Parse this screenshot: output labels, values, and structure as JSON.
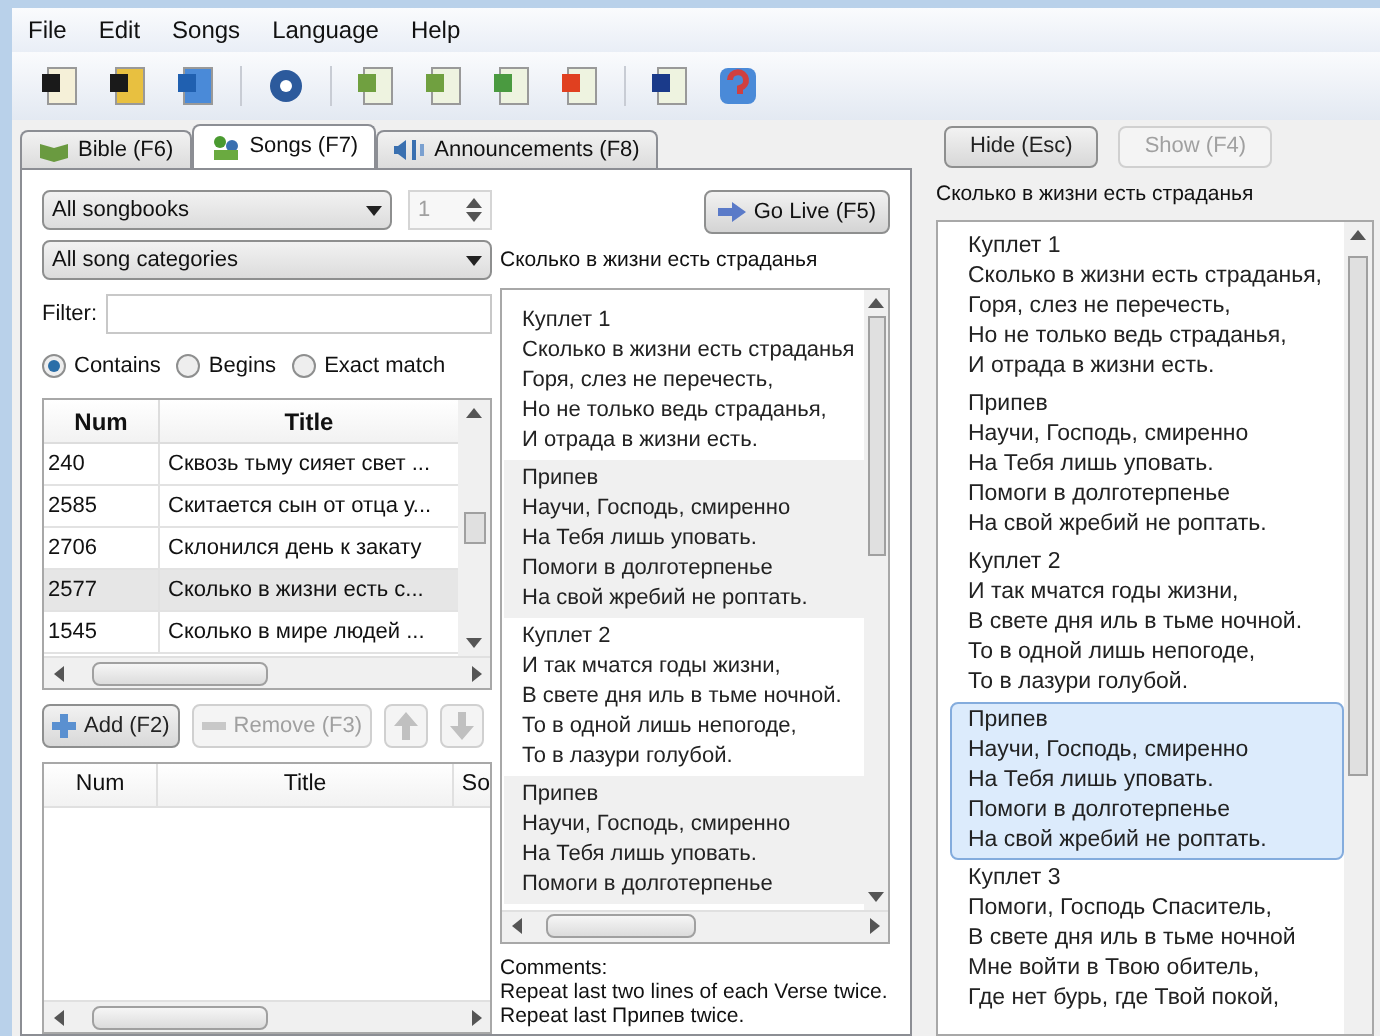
{
  "menu": [
    "File",
    "Edit",
    "Songs",
    "Language",
    "Help"
  ],
  "tabs": [
    {
      "label": "Bible (F6)",
      "selected": false,
      "kind": "book"
    },
    {
      "label": "Songs (F7)",
      "selected": true,
      "kind": "songs"
    },
    {
      "label": "Announcements (F8)",
      "selected": false,
      "kind": "speaker"
    }
  ],
  "songbook_select": {
    "value": "All songbooks"
  },
  "songbook_number": {
    "value": "1",
    "disabled": true
  },
  "category_select": {
    "value": "All song categories"
  },
  "filter": {
    "label": "Filter:"
  },
  "match_options": [
    {
      "label": "Contains",
      "selected": true
    },
    {
      "label": "Begins",
      "selected": false
    },
    {
      "label": "Exact match",
      "selected": false
    }
  ],
  "songs_table": {
    "columns": [
      "Num",
      "Title"
    ],
    "rows": [
      {
        "num": "240",
        "title": "Сквозь тьму сияет свет ...",
        "selected": false
      },
      {
        "num": "2585",
        "title": "Скитается сын от отца у...",
        "selected": false
      },
      {
        "num": "2706",
        "title": "Склонился день к закату",
        "selected": false
      },
      {
        "num": "2577",
        "title": "Сколько в жизни есть с...",
        "selected": true
      },
      {
        "num": "1545",
        "title": "Сколько в мире людей ...",
        "selected": false
      }
    ]
  },
  "playlist_buttons": [
    {
      "label": "Add (F2)",
      "kind": "add",
      "disabled": false
    },
    {
      "label": "Remove (F3)",
      "kind": "remove",
      "disabled": true
    },
    {
      "kind": "up",
      "disabled": true
    },
    {
      "kind": "down",
      "disabled": true
    }
  ],
  "playlist_table": {
    "columns": [
      "Num",
      "Title",
      "So"
    ]
  },
  "go_live": {
    "label": "Go Live (F5)"
  },
  "preview": {
    "title": "Сколько в жизни есть страданья",
    "stanzas": [
      {
        "lines": [
          "Куплет 1",
          "Сколько в жизни есть страданья",
          "Горя, слез не перечесть,",
          "Но не только ведь страданья,",
          "И отрада в жизни есть."
        ]
      },
      {
        "lines": [
          "Припев",
          "Научи, Господь, смиренно",
          "На Тебя лишь уповать.",
          "Помоги в долготерпенье",
          "На свой жребий не роптать."
        ]
      },
      {
        "lines": [
          "Куплет 2",
          "И так мчатся годы жизни,",
          "В свете дня иль в тьме ночной.",
          "То в одной лишь непогоде,",
          "То в лазури голубой."
        ]
      },
      {
        "lines": [
          "Припев",
          "Научи, Господь, смиренно",
          "На Тебя лишь уповать.",
          "Помоги в долготерпенье"
        ]
      }
    ],
    "comments": [
      "Comments:",
      "Repeat last two lines of each Verse twice.",
      "Repeat last Припев twice."
    ]
  },
  "live_buttons": [
    {
      "label": "Hide (Esc)",
      "disabled": false
    },
    {
      "label": "Show (F4)",
      "disabled": true
    }
  ],
  "live": {
    "title": "Сколько в жизни есть страданья",
    "stanzas": [
      {
        "selected": false,
        "lines": [
          "Куплет 1",
          "Сколько в жизни есть страданья,",
          "Горя, слез не перечесть,",
          "Но не только ведь страданья,",
          "И отрада в жизни есть."
        ]
      },
      {
        "selected": false,
        "lines": [
          "Припев",
          "Научи, Господь, смиренно",
          "На Тебя лишь уповать.",
          "Помоги в долготерпенье",
          "На свой жребий не роптать."
        ]
      },
      {
        "selected": false,
        "lines": [
          "Куплет 2",
          "И так мчатся годы жизни,",
          "В свете дня иль в тьме ночной.",
          "То в одной лишь непогоде,",
          "То в лазури голубой."
        ]
      },
      {
        "selected": true,
        "lines": [
          "Припев",
          "Научи, Господь, смиренно",
          "На Тебя лишь уповать.",
          "Помоги в долготерпенье",
          "На свой жребий не роптать."
        ]
      },
      {
        "selected": false,
        "lines": [
          "Куплет 3",
          "Помоги, Господь Спаситель,",
          "В свете дня иль в тьме ночной",
          "Мне войти в Твою обитель,",
          "Где нет бурь, где Твой покой,"
        ]
      }
    ]
  }
}
